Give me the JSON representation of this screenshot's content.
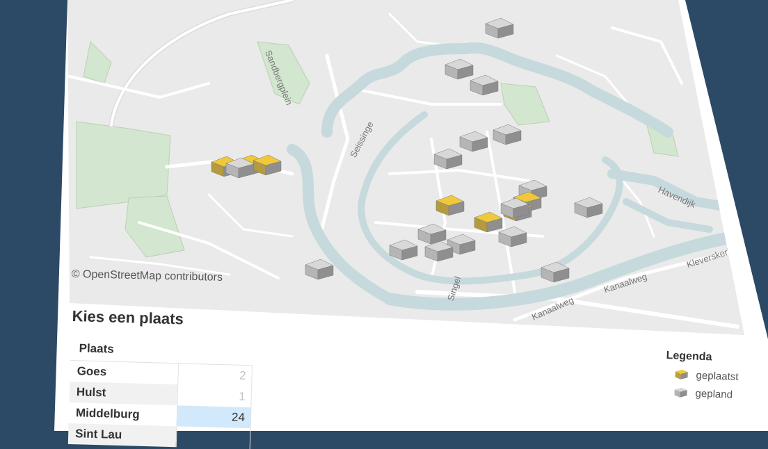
{
  "map": {
    "attribution": "© OpenStreetMap contributors",
    "streets": [
      "Sandbergplein",
      "Seissinge",
      "Havendijk",
      "Kleverskerke",
      "Kanaalweg",
      "Kanaalweg",
      "Singel"
    ],
    "colors": {
      "background": "#eaeaea",
      "water": "#c6d9dc",
      "green": "#d3e6cf",
      "road": "#ffffff",
      "placed": "#e0b117",
      "planned": "#c7c7c7"
    },
    "markers": [
      {
        "status": "gepland"
      },
      {
        "status": "gepland"
      },
      {
        "status": "gepland"
      },
      {
        "status": "geplaatst"
      },
      {
        "status": "geplaatst"
      },
      {
        "status": "geplaatst"
      },
      {
        "status": "gepland"
      },
      {
        "status": "gepland"
      },
      {
        "status": "gepland"
      },
      {
        "status": "geplaatst"
      },
      {
        "status": "gepland"
      },
      {
        "status": "geplaatst"
      },
      {
        "status": "geplaatst"
      },
      {
        "status": "geplaatst"
      },
      {
        "status": "gepland"
      },
      {
        "status": "gepland"
      },
      {
        "status": "gepland"
      },
      {
        "status": "gepland"
      },
      {
        "status": "gepland"
      },
      {
        "status": "gepland"
      },
      {
        "status": "gepland"
      },
      {
        "status": "gepland"
      },
      {
        "status": "gepland"
      },
      {
        "status": "gepland"
      }
    ]
  },
  "panel": {
    "title": "Kies een plaats",
    "column_header": "Plaats",
    "rows": [
      {
        "name": "Goes",
        "count": "2"
      },
      {
        "name": "Hulst",
        "count": "1"
      },
      {
        "name": "Middelburg",
        "count": "24"
      },
      {
        "name": "Sint Lau",
        "count": ""
      }
    ]
  },
  "legend": {
    "title": "Legenda",
    "items": [
      {
        "label": "geplaatst",
        "icon": "placed-box-icon"
      },
      {
        "label": "gepland",
        "icon": "planned-box-icon"
      }
    ]
  }
}
